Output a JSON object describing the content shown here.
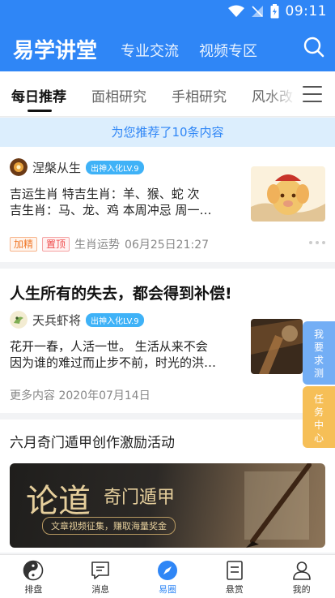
{
  "status": {
    "time": "09:11"
  },
  "header": {
    "title": "易学讲堂",
    "nav": [
      "专业交流",
      "视频专区"
    ]
  },
  "tabs": [
    "每日推荐",
    "面相研究",
    "手相研究",
    "风水改"
  ],
  "banner": "为您推荐了10条内容",
  "posts": [
    {
      "author": "涅槃从生",
      "level": "出神入化LV.9",
      "text_lines": [
        "吉运生肖  特吉生肖：羊、猴、蛇    次",
        "吉生肖：马、龙、鸡    本周冲忌  周一…"
      ],
      "tags": [
        "加精",
        "置顶"
      ],
      "category": "生肖运势",
      "date": "06月25日21:27"
    },
    {
      "headline": "人生所有的失去，都会得到补偿!",
      "author": "天兵虾将",
      "level": "出神入化LV.9",
      "text_lines": [
        "花开一春，人活一世。  生活从来不会",
        "因为谁的难过而止步不前，时光的洪…"
      ],
      "more": "更多内容",
      "date": "2020年07月14日"
    }
  ],
  "event": {
    "title": "六月奇门遁甲创作激励活动",
    "banner_big": "论道",
    "banner_sub": "奇门遁甲",
    "banner_pill": "文章视频征集，赚取海量奖金"
  },
  "side_tabs": [
    "我要求测",
    "任务中心"
  ],
  "bottom_nav": [
    {
      "label": "排盘",
      "icon": "yin-yang-icon"
    },
    {
      "label": "消息",
      "icon": "message-icon"
    },
    {
      "label": "易圈",
      "icon": "compass-icon"
    },
    {
      "label": "悬赏",
      "icon": "document-icon"
    },
    {
      "label": "我的",
      "icon": "user-icon"
    }
  ],
  "colors": {
    "primary": "#2f86f6",
    "banner_bg": "#dceefd",
    "badge": "#3fb2f7",
    "task": "#f6bf57",
    "request": "#73aef5"
  }
}
